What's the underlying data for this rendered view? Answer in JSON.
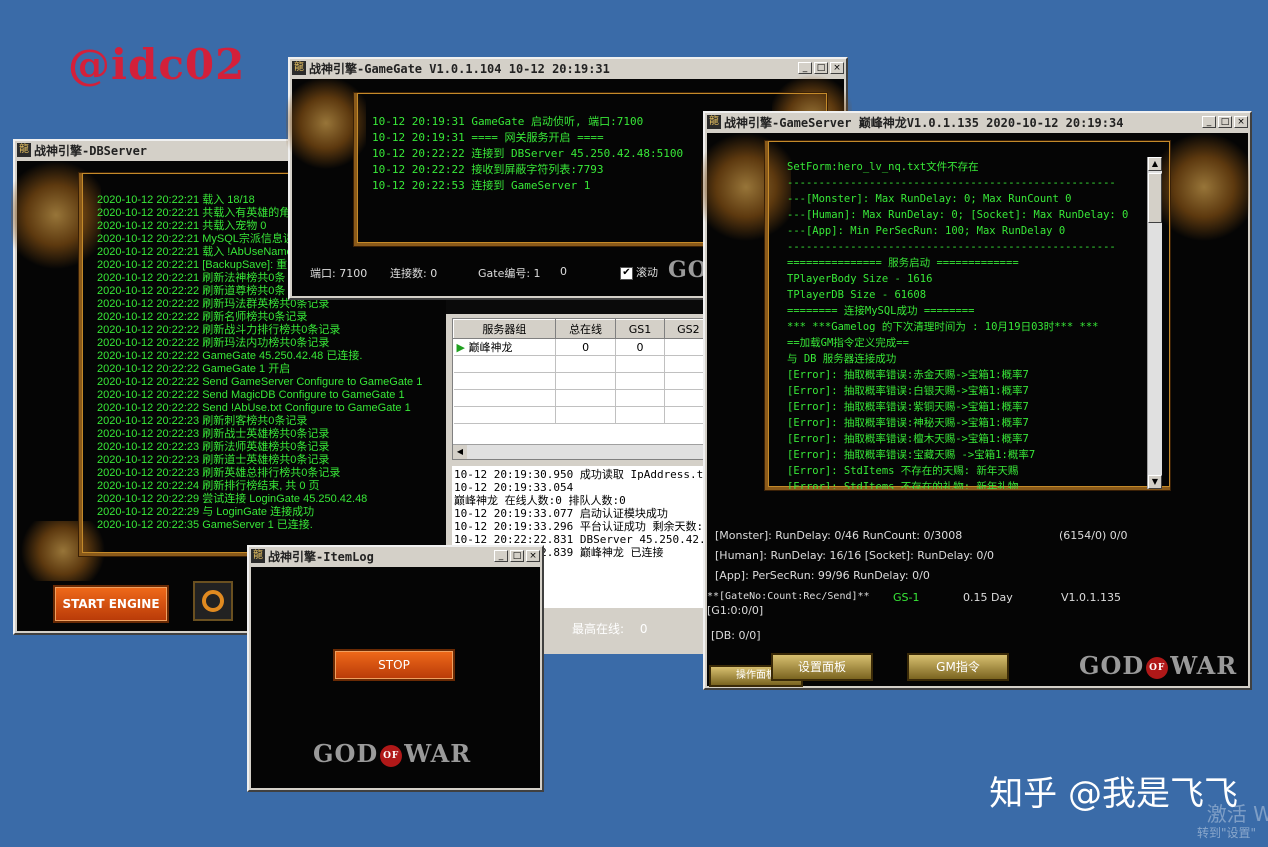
{
  "watermark": "@idc02",
  "footer_watermark": "知乎 @我是飞飞",
  "activation": {
    "line1": "激活 Wi",
    "line2": "转到\"设置\""
  },
  "db": {
    "title": "战神引擎-DBServer",
    "log": [
      "2020-10-12 20:22:21 载入 18/18",
      "2020-10-12 20:22:21 共载入有英雄的角",
      "2020-10-12 20:22:21 共载入宠物 0",
      "2020-10-12 20:22:21 MySQL宗派信息读",
      "2020-10-12 20:22:21 载入 !AbUseName",
      "2020-10-12 20:22:21 [BackupSave]: 重",
      "2020-10-12 20:22:21 刷新法神榜共0条",
      "2020-10-12 20:22:22 刷新道尊榜共0条",
      "2020-10-12 20:22:22 刷新玛法群英榜共0条记录",
      "2020-10-12 20:22:22 刷新名师榜共0条记录",
      "2020-10-12 20:22:22 刷新战斗力排行榜共0条记录",
      "2020-10-12 20:22:22 刷新玛法内功榜共0条记录",
      "2020-10-12 20:22:22 GameGate 45.250.42.48 已连接.",
      "2020-10-12 20:22:22 GameGate 1 开启",
      "2020-10-12 20:22:22 Send GameServer Configure to GameGate 1",
      "2020-10-12 20:22:22 Send MagicDB Configure to GameGate 1",
      "2020-10-12 20:22:22 Send !AbUse.txt Configure to GameGate 1",
      "2020-10-12 20:22:23 刷新刺客榜共0条记录",
      "2020-10-12 20:22:23 刷新战士英雄榜共0条记录",
      "2020-10-12 20:22:23 刷新法师英雄榜共0条记录",
      "2020-10-12 20:22:23 刷新道士英雄榜共0条记录",
      "2020-10-12 20:22:23 刷新英雄总排行榜共0条记录",
      "2020-10-12 20:22:24 刷新排行榜结束, 共 0 页",
      "2020-10-12 20:22:29 尝试连接 LoginGate 45.250.42.48",
      "2020-10-12 20:22:29 与 LoginGate 连接成功",
      "2020-10-12 20:22:35 GameServer 1 已连接."
    ],
    "start_button": "START ENGINE"
  },
  "gamegate": {
    "title": "战神引擎-GameGate V1.0.1.104 10-12 20:19:31",
    "log": [
      "10-12 20:19:31 GameGate 启动侦听, 端口:7100",
      "10-12 20:19:31 ==== 网关服务开启 ====",
      "10-12 20:22:22 连接到 DBServer 45.250.42.48:5100",
      "10-12 20:22:22 接收到屏蔽字符列表:7793",
      "10-12 20:22:53 连接到 GameServer 1"
    ],
    "port_label": "端口: 7100",
    "conn_label": "连接数: 0",
    "gate_label": "Gate编号: 1",
    "gate_value": "0",
    "scroll_label": "滚动"
  },
  "login": {
    "columns": [
      "服务器组",
      "总在线",
      "GS1",
      "GS2"
    ],
    "rows": [
      {
        "name": "巅峰神龙",
        "total": "0",
        "gs1": "0",
        "gs2": ""
      }
    ],
    "log": [
      "10-12 20:19:30.950 成功读取 IpAddress.txt",
      "10-12 20:19:33.054",
      "巅峰神龙 在线人数:0 排队人数:0",
      "",
      "10-12 20:19:33.077 启动认证模块成功",
      "10-12 20:19:33.296 平台认证成功 剩余天数:9",
      "10-12 20:22:22.831 DBServer 45.250.42.48 已",
      "10-12 20:22:22.839 巅峰神龙 已连接"
    ],
    "max_online": "最高在线:",
    "max_online_value": "0"
  },
  "gameserver": {
    "title": "战神引擎-GameServer 巅峰神龙V1.0.1.135 2020-10-12 20:19:34",
    "log": [
      "SetForm:hero_lv_nq.txt文件不存在",
      "----------------------------------------------------",
      "---[Monster]: Max RunDelay: 0; Max RunCount 0",
      "---[Human]: Max RunDelay: 0; [Socket]: Max RunDelay: 0",
      "---[App]: Min PerSecRun: 100; Max RunDelay 0",
      "----------------------------------------------------",
      "=============== 服务启动 =============",
      "TPlayerBody Size - 1616",
      "TPlayerDB Size - 61608",
      "======== 连接MySQL成功 ========",
      "*** ***Gamelog 的下次清理时间为 : 10月19日03时*** ***",
      "==加载GM指令定义完成==",
      "与 DB 服务器连接成功",
      "[Error]: 抽取概率错误:赤金天赐->宝箱1:概率7",
      "[Error]: 抽取概率错误:白银天赐->宝箱1:概率7",
      "[Error]: 抽取概率错误:紫铜天赐->宝箱1:概率7",
      "[Error]: 抽取概率错误:神秘天赐->宝箱1:概率7",
      "[Error]: 抽取概率错误:檀木天赐->宝箱1:概率7",
      "[Error]: 抽取概率错误:宝藏天赐 ->宝箱1:概率7",
      "[Error]: StdItems 不存在的天赐: 新年天赐",
      "[Error]: StdItems 不存在的礼物: 新年礼物"
    ],
    "stats": {
      "monster": "[Monster]: RunDelay: 0/46  RunCount: 0/3008",
      "monster_right": "(6154/0) 0/0",
      "human": "[Human]: RunDelay: 16/16  [Socket]: RunDelay: 0/0",
      "app": "[App]: PerSecRun: 99/96  RunDelay: 0/0",
      "gate_header": "**[GateNo:Count:Rec/Send]**",
      "gs": "GS-1",
      "day": "0.15 Day",
      "version": "V1.0.1.135",
      "gate_value": "[G1:0:0/0]",
      "db": "[DB: 0/0]"
    },
    "btn_settings": "设置面板",
    "btn_gm": "GM指令",
    "btn_ops": "操作面板"
  },
  "itemlog": {
    "title": "战神引擎-ItemLog",
    "stop_button": "STOP"
  },
  "gow": {
    "god": "GOD",
    "of": "OF",
    "war": "WAR"
  }
}
